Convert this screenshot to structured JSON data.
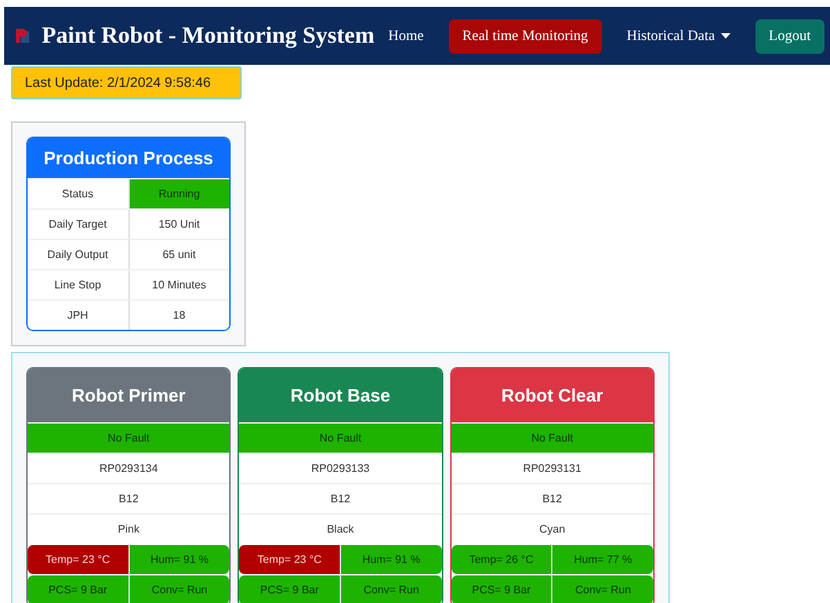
{
  "navbar": {
    "title": "Paint Robot - Monitoring System",
    "items": [
      {
        "label": "Home",
        "kind": "link",
        "selected": false
      },
      {
        "label": "Real time Monitoring",
        "kind": "link",
        "selected": true
      },
      {
        "label": "Historical Data",
        "kind": "dropdown",
        "selected": false
      },
      {
        "label": "Logout",
        "kind": "button",
        "selected": false
      }
    ]
  },
  "last_update": "Last Update: 2/1/2024 9:58:46",
  "production_process": {
    "title": "Production Process",
    "rows": [
      {
        "label": "Status",
        "value": "Running",
        "running": true
      },
      {
        "label": "Daily Target",
        "value": "150 Unit",
        "running": false
      },
      {
        "label": "Daily Output",
        "value": "65 unit",
        "running": false
      },
      {
        "label": "Line Stop",
        "value": "10 Minutes",
        "running": false
      },
      {
        "label": "JPH",
        "value": "18",
        "running": false
      }
    ]
  },
  "robots": [
    {
      "name": "Robot Primer",
      "color": "#6c757d",
      "fault_status": "No Fault",
      "fault": false,
      "id": "RP0293134",
      "model": "B12",
      "paint": "Pink",
      "temp": "Temp= 23 °C",
      "temp_alarm": true,
      "hum": "Hum= 91 %",
      "hum_alarm": false,
      "pcs": "PCS= 9 Bar",
      "pcs_alarm": false,
      "conv": "Conv= Run",
      "conv_alarm": false
    },
    {
      "name": "Robot Base",
      "color": "#198754",
      "fault_status": "No Fault",
      "fault": false,
      "id": "RP0293133",
      "model": "B12",
      "paint": "Black",
      "temp": "Temp= 23 °C",
      "temp_alarm": true,
      "hum": "Hum= 91 %",
      "hum_alarm": false,
      "pcs": "PCS= 9 Bar",
      "pcs_alarm": false,
      "conv": "Conv= Run",
      "conv_alarm": false
    },
    {
      "name": "Robot Clear",
      "color": "#dc3545",
      "fault_status": "No Fault",
      "fault": false,
      "id": "RP0293131",
      "model": "B12",
      "paint": "Cyan",
      "temp": "Temp= 26 °C",
      "temp_alarm": false,
      "hum": "Hum= 77 %",
      "hum_alarm": false,
      "pcs": "PCS= 9 Bar",
      "pcs_alarm": false,
      "conv": "Conv= Run",
      "conv_alarm": false
    }
  ]
}
